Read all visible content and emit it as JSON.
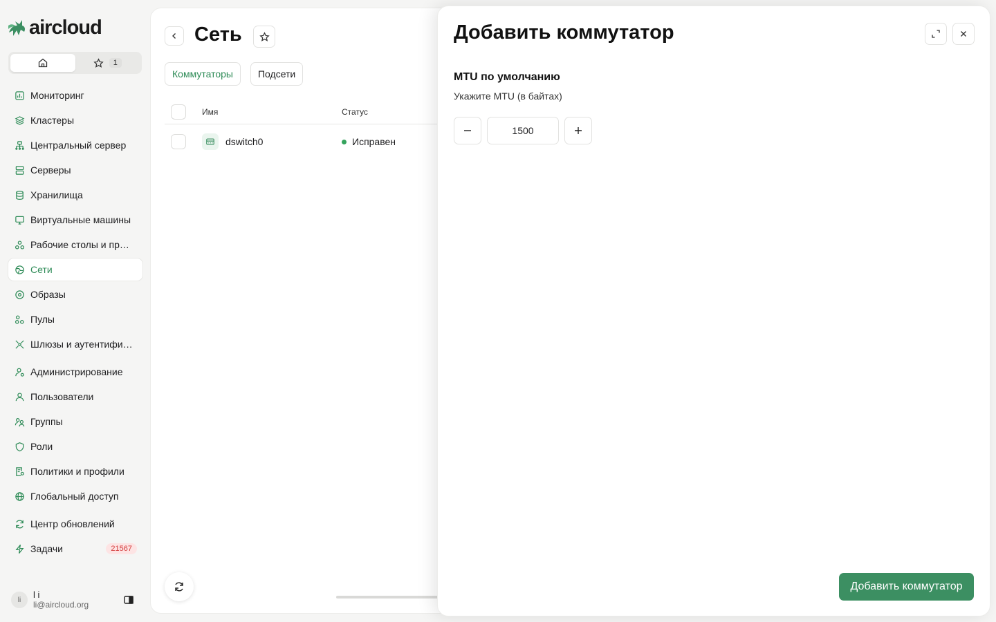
{
  "brand": {
    "name": "aircloud",
    "accent": "#2e8b57"
  },
  "sidebar": {
    "segments": {
      "favorites_count": "1"
    },
    "items": [
      {
        "label": "Мониторинг",
        "icon": "chart-icon"
      },
      {
        "label": "Кластеры",
        "icon": "layers-icon"
      },
      {
        "label": "Центральный сервер",
        "icon": "server-tree-icon"
      },
      {
        "label": "Серверы",
        "icon": "server-icon"
      },
      {
        "label": "Хранилища",
        "icon": "database-icon"
      },
      {
        "label": "Виртуальные машины",
        "icon": "monitor-icon"
      },
      {
        "label": "Рабочие столы и приложения",
        "icon": "apps-icon"
      },
      {
        "label": "Сети",
        "icon": "network-icon",
        "active": true
      },
      {
        "label": "Образы",
        "icon": "disc-icon"
      },
      {
        "label": "Пулы",
        "icon": "pool-icon"
      },
      {
        "label": "Шлюзы и аутентификация",
        "icon": "gateway-icon"
      },
      {
        "label": "Администрирование",
        "icon": "admin-icon"
      },
      {
        "label": "Пользователи",
        "icon": "user-icon"
      },
      {
        "label": "Группы",
        "icon": "group-icon"
      },
      {
        "label": "Роли",
        "icon": "shield-icon"
      },
      {
        "label": "Политики и профили",
        "icon": "policy-icon"
      },
      {
        "label": "Глобальный доступ",
        "icon": "globe-icon"
      },
      {
        "label": "Центр обновлений",
        "icon": "refresh-icon"
      },
      {
        "label": "Задачи",
        "icon": "bolt-icon",
        "badge": "21567"
      }
    ],
    "user": {
      "initials": "li",
      "name": "l i",
      "email": "li@aircloud.org"
    }
  },
  "main": {
    "title": "Сеть",
    "tabs": [
      {
        "label": "Коммутаторы",
        "active": true
      },
      {
        "label": "Подсети"
      }
    ],
    "table": {
      "columns": {
        "name": "Имя",
        "status": "Статус"
      },
      "rows": [
        {
          "name": "dswitch0",
          "status": "Исправен"
        }
      ]
    }
  },
  "drawer": {
    "title": "Добавить коммутатор",
    "field_label": "MTU по умолчанию",
    "field_hint": "Укажите MTU (в байтах)",
    "mtu_value": "1500",
    "submit_label": "Добавить коммутатор"
  }
}
